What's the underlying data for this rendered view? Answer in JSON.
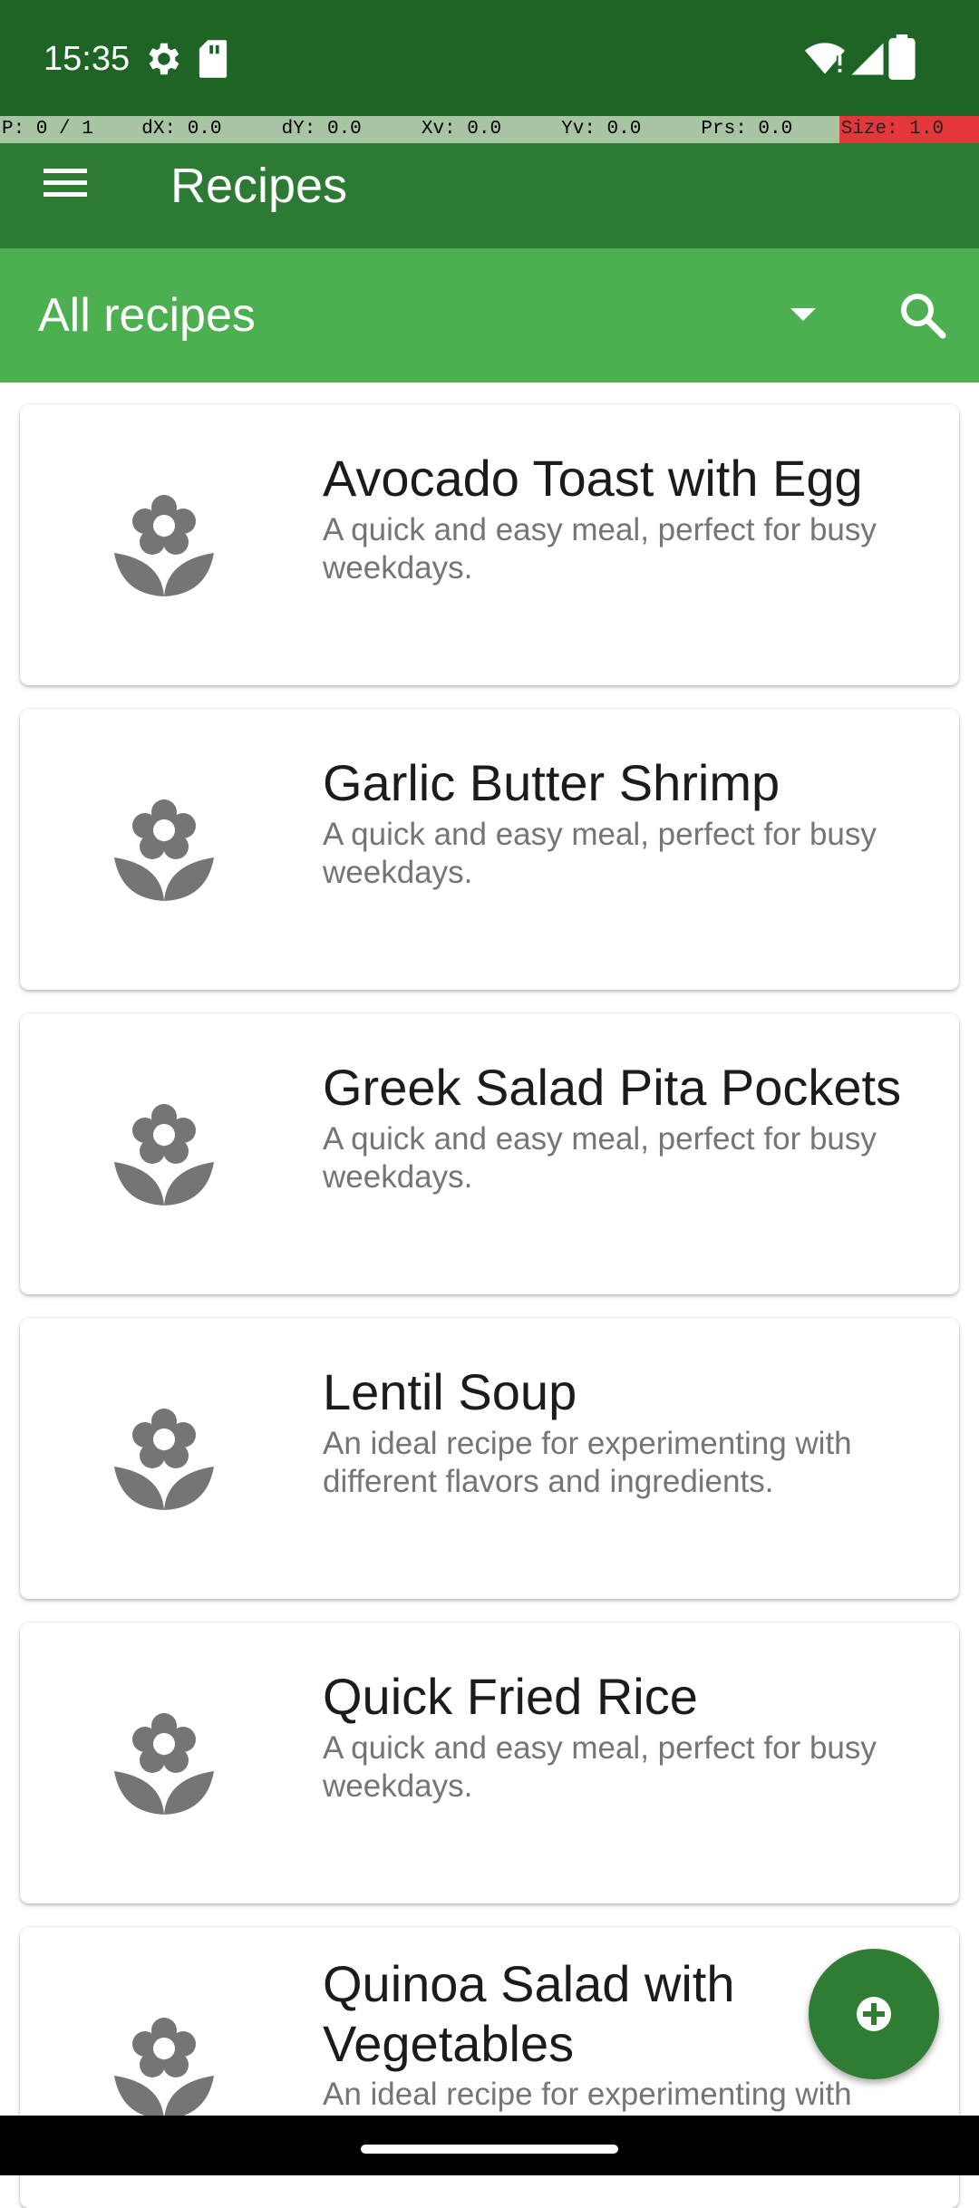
{
  "status_bar": {
    "time": "15:35",
    "icons": [
      "gear-icon",
      "sd-card-icon",
      "wifi-alert-icon",
      "signal-icon",
      "battery-icon"
    ]
  },
  "pointer_info": {
    "p": "P: 0 / 1",
    "dx": "dX: 0.0",
    "dy": "dY: 0.0",
    "xv": "Xv: 0.0",
    "yv": "Yv: 0.0",
    "prs": "Prs: 0.0",
    "size": "Size: 1.0"
  },
  "app_bar": {
    "title": "Recipes",
    "menu_icon": "hamburger-menu-icon"
  },
  "filter": {
    "selected": "All recipes",
    "dropdown_icon": "dropdown-arrow-icon",
    "search_icon": "search-icon"
  },
  "recipes": [
    {
      "title": "Avocado Toast with Egg",
      "description": "A quick and easy meal, perfect for busy weekdays."
    },
    {
      "title": "Garlic Butter Shrimp",
      "description": "A quick and easy meal, perfect for busy weekdays."
    },
    {
      "title": "Greek Salad Pita Pockets",
      "description": "A quick and easy meal, perfect for busy weekdays."
    },
    {
      "title": "Lentil Soup",
      "description": "An ideal recipe for experimenting with different flavors and ingredients."
    },
    {
      "title": "Quick Fried Rice",
      "description": "A quick and easy meal, perfect for busy weekdays."
    },
    {
      "title": "Quinoa Salad with Vegetables",
      "description": "An ideal recipe for experimenting with different flavors and ingredients."
    }
  ],
  "fab_icon": "add-icon",
  "colors": {
    "status_bar": "#1E6424",
    "app_bar": "#2C7A33",
    "filter_bar": "#4CAF50",
    "fab": "#2E7D32",
    "thumb_icon": "#757575"
  }
}
